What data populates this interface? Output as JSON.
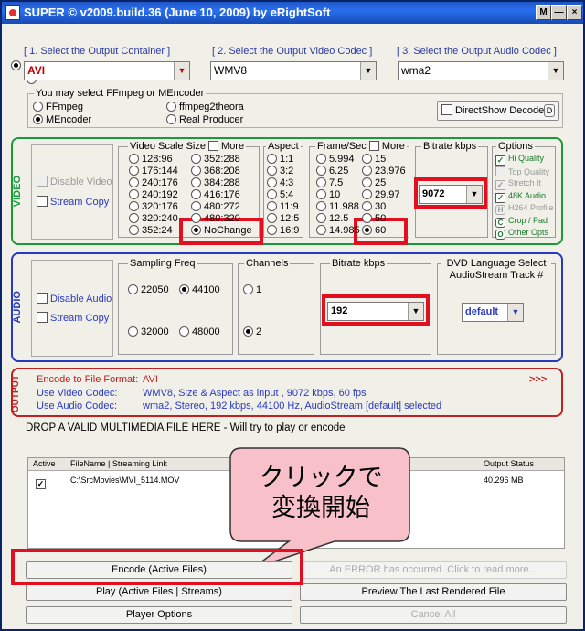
{
  "window": {
    "title": "SUPER © v2009.build.36 (June 10, 2009) by eRightSoft",
    "buttons": [
      "M",
      "—",
      "×"
    ]
  },
  "steps": {
    "s1": "[ 1.      Select the Output Container ]",
    "s2": "[ 2.   Select the Output Video Codec ]",
    "s3": "[ 3.    Select the Output Audio Codec ]"
  },
  "container": "AVI",
  "video_codec": "WMV8",
  "audio_codec": "wma2",
  "encoder": {
    "legend": "You may select FFmpeg or MEncoder",
    "options": [
      "FFmpeg",
      "MEncoder",
      "ffmpeg2theora",
      "Real Producer"
    ],
    "selected": "MEncoder",
    "directshow": "DirectShow Decode",
    "directshow_badge": "D"
  },
  "video": {
    "section": "VIDEO",
    "disable": "Disable Video",
    "stream_copy": "Stream Copy",
    "scale": {
      "legend": "Video Scale Size",
      "more": "More",
      "col1": [
        "128:96",
        "176:144",
        "240:176",
        "240:192",
        "320:176",
        "320:240",
        "352:24"
      ],
      "col2": [
        "352:288",
        "368:208",
        "384:288",
        "416:176",
        "480:272",
        "480:320",
        "NoChange"
      ],
      "selected": "NoChange"
    },
    "aspect": {
      "legend": "Aspect",
      "items": [
        "1:1",
        "3:2",
        "4:3",
        "5:4",
        "11:9",
        "12:5",
        "16:9"
      ]
    },
    "framerate": {
      "legend": "Frame/Sec",
      "more": "More",
      "col1": [
        "5.994",
        "6.25",
        "7.5",
        "10",
        "11.988",
        "12.5",
        "14.985"
      ],
      "col2": [
        "15",
        "23.976",
        "25",
        "29.97",
        "30",
        "50",
        "60"
      ],
      "selected": "60"
    },
    "bitrate": {
      "legend": "Bitrate  kbps",
      "value": "9072"
    },
    "options": {
      "legend": "Options",
      "items": [
        {
          "label": "Hi Quality",
          "checked": true,
          "enabled": true
        },
        {
          "label": "Top Quality",
          "checked": false,
          "enabled": false
        },
        {
          "label": "Stretch It",
          "checked": true,
          "enabled": false
        },
        {
          "label": "48K Audio",
          "checked": true,
          "enabled": true
        },
        {
          "label": "H264 Profile",
          "badge": "H",
          "enabled": false
        },
        {
          "label": "Crop / Pad",
          "badge": "C",
          "enabled": true
        },
        {
          "label": "Other Opts",
          "badge": "O",
          "enabled": true
        }
      ]
    }
  },
  "audio": {
    "section": "AUDIO",
    "disable": "Disable Audio",
    "stream_copy": "Stream Copy",
    "sampling": {
      "legend": "Sampling Freq",
      "items": [
        "22050",
        "44100",
        "32000",
        "48000"
      ],
      "selected": "44100"
    },
    "channels": {
      "legend": "Channels",
      "items": [
        "1",
        "2"
      ],
      "selected": "2"
    },
    "bitrate": {
      "legend": "Bitrate  kbps",
      "value": "192"
    },
    "dvd": {
      "legend1": "DVD Language Select",
      "legend2": "AudioStream  Track #",
      "value": "default"
    }
  },
  "output": {
    "section": "OUTPUT",
    "l1": "Encode to File Format:",
    "v1": "AVI",
    "l2": "Use Video Codec:",
    "v2": "WMV8,  Size & Aspect as input ,  9072 kbps,  60 fps",
    "l3": "Use Audio Codec:",
    "v3": "wma2,  Stereo,  192 kbps,  44100 Hz,  AudioStream [default] selected",
    "arrows": ">>>"
  },
  "drop_text": "DROP A VALID MULTIMEDIA FILE HERE - Will try to play or encode",
  "table": {
    "headers": [
      "Active",
      "FileName  |  Streaming Link",
      "Output Status"
    ],
    "rows": [
      {
        "file": "C:\\SrcMovies\\MVI_5114.MOV",
        "status": "40.296 MB"
      }
    ]
  },
  "callout": {
    "line1": "クリックで",
    "line2": "変換開始"
  },
  "buttons": {
    "encode": "Encode (Active Files)",
    "error": "An ERROR has occurred. Click to read more...",
    "play": "Play (Active Files | Streams)",
    "preview": "Preview The Last Rendered File",
    "player_options": "Player Options",
    "cancel": "Cancel All"
  },
  "colors": {
    "video_border": "#1a9a3a",
    "audio_border": "#2a3ac0",
    "output_border": "#c02020",
    "highlight": "#e01020",
    "callout": "#f8c0c8"
  }
}
